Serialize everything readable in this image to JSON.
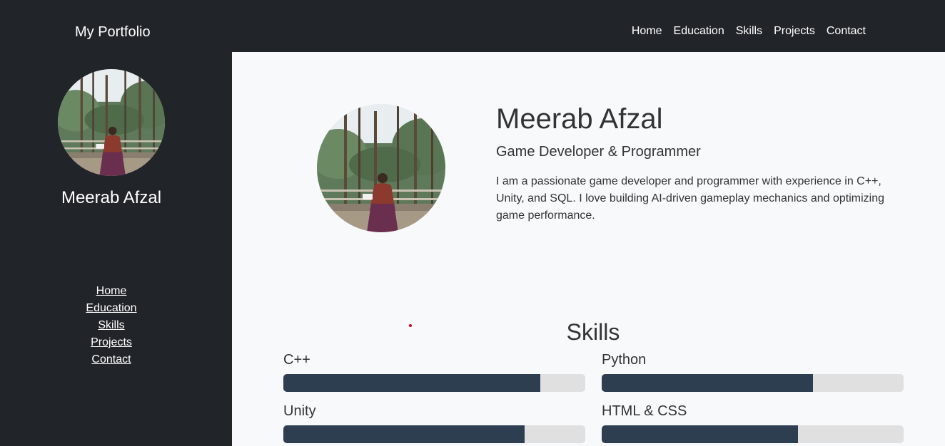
{
  "header": {
    "brand": "My Portfolio",
    "nav": [
      {
        "label": "Home"
      },
      {
        "label": "Education"
      },
      {
        "label": "Skills"
      },
      {
        "label": "Projects"
      },
      {
        "label": "Contact"
      }
    ]
  },
  "sidebar": {
    "name": "Meerab Afzal",
    "nav": [
      {
        "label": "Home"
      },
      {
        "label": "Education"
      },
      {
        "label": "Skills"
      },
      {
        "label": "Projects"
      },
      {
        "label": "Contact"
      }
    ]
  },
  "hero": {
    "name": "Meerab Afzal",
    "role": "Game Developer & Programmer",
    "bio": "I am a passionate game developer and programmer with experience in C++, Unity, and SQL. I love building AI-driven gameplay mechanics and optimizing game performance."
  },
  "skills": {
    "title": "Skills",
    "items": [
      {
        "label": "C++",
        "level_percent": 85
      },
      {
        "label": "Python",
        "level_percent": 70
      },
      {
        "label": "Unity",
        "level_percent": 80
      },
      {
        "label": "HTML & CSS",
        "level_percent": 65
      }
    ]
  },
  "colors": {
    "dark_bg": "#212529",
    "main_bg": "#f8f9fa",
    "bar_fill": "#2d3e50",
    "bar_track": "#e0e0e0"
  }
}
